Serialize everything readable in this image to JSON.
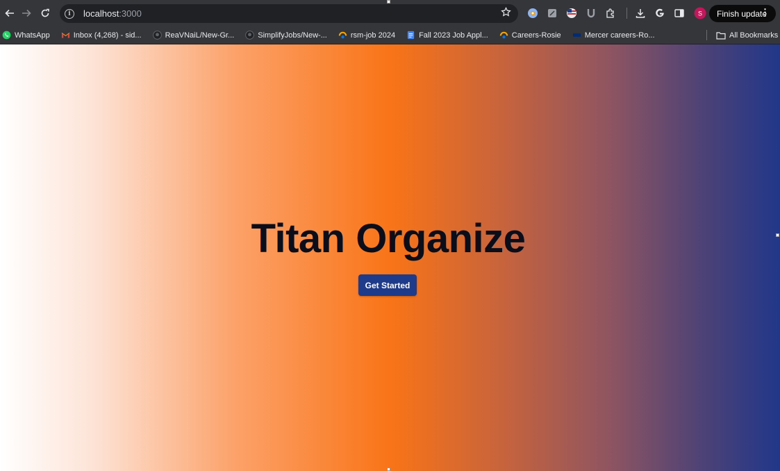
{
  "browser": {
    "url_host": "localhost",
    "url_port": ":3000",
    "finish_update_label": "Finish update",
    "profile_initial": "S",
    "profile_color": "#c2185b",
    "nav_icons": [
      "back-arrow-icon",
      "forward-arrow-icon",
      "reload-icon"
    ],
    "extension_icons": [
      "chrome-ext-icon",
      "notes-ext-icon",
      "flag-ext-icon",
      "u-ext-icon",
      "puzzle-icon",
      "download-icon",
      "google-icon",
      "side-panel-icon"
    ]
  },
  "bookmarks": {
    "items": [
      {
        "label": "WhatsApp",
        "icon": "whatsapp-icon"
      },
      {
        "label": "Inbox (4,268) - sid...",
        "icon": "gmail-icon"
      },
      {
        "label": "ReaVNaiL/New-Gr...",
        "icon": "github-icon"
      },
      {
        "label": "SimplifyJobs/New-...",
        "icon": "github-icon"
      },
      {
        "label": "rsm-job 2024",
        "icon": "workday-icon"
      },
      {
        "label": "Fall 2023 Job Appl...",
        "icon": "docs-icon"
      },
      {
        "label": "Careers-Rosie",
        "icon": "workday-icon"
      },
      {
        "label": "Mercer careers-Ro...",
        "icon": "mercer-icon"
      }
    ],
    "all_bookmarks_label": "All Bookmarks"
  },
  "page": {
    "title": "Titan Organize",
    "cta_label": "Get Started",
    "cta_color": "#1e3a8a",
    "gradient_colors": [
      "#ffffff",
      "#f97417",
      "#21378a"
    ]
  }
}
